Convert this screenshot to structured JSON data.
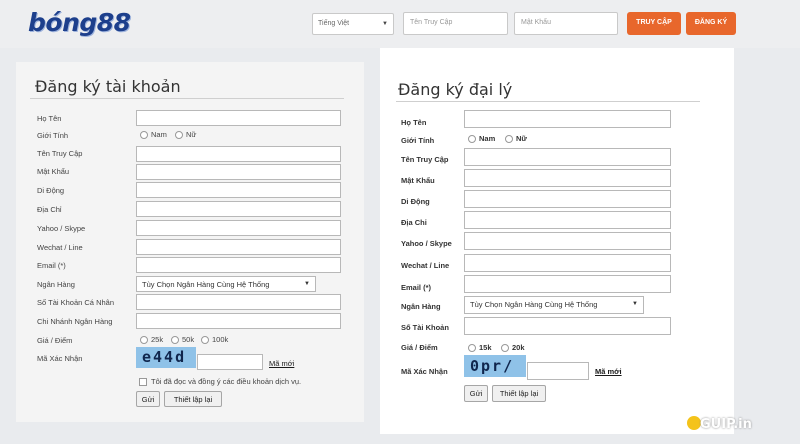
{
  "header": {
    "logo": "bóng88",
    "language": "Tiếng Việt",
    "username_placeholder": "Tên Truy Cập",
    "password_placeholder": "Mật Khẩu",
    "login_button": "TRUY CẬP",
    "register_button": "ĐĂNG KÝ"
  },
  "account_form": {
    "title": "Đăng ký tài khoản",
    "labels": {
      "fullname": "Họ Tên",
      "gender": "Giới Tính",
      "username": "Tên Truy Cập",
      "password": "Mật Khẩu",
      "mobile": "Di Động",
      "address": "Địa Chỉ",
      "yahoo": "Yahoo / Skype",
      "wechat": "Wechat / Line",
      "email": "Email (*)",
      "bank": "Ngân Hàng",
      "account_number": "Số Tài Khoản Cá Nhân",
      "branch": "Chi Nhánh Ngân Hàng",
      "price": "Giá / Điểm",
      "captcha": "Mã Xác Nhận"
    },
    "gender_options": [
      "Nam",
      "Nữ"
    ],
    "bank_selected": "Tùy Chọn Ngân Hàng Cùng Hệ Thống",
    "price_options": [
      "25k",
      "50k",
      "100k"
    ],
    "captcha_text": "e44d",
    "refresh_link": "Mã mới",
    "terms": "Tôi đã đọc và đồng ý các điều khoản dịch vụ.",
    "submit": "Gửi",
    "reset": "Thiết lập lại"
  },
  "agent_form": {
    "title": "Đăng ký đại lý",
    "labels": {
      "fullname": "Họ Tên",
      "gender": "Giới Tính",
      "username": "Tên Truy Cập",
      "password": "Mật Khẩu",
      "mobile": "Di Động",
      "address": "Địa Chỉ",
      "yahoo": "Yahoo / Skype",
      "wechat": "Wechat / Line",
      "email": "Email (*)",
      "bank": "Ngân Hàng",
      "account_number": "Số Tài Khoản",
      "price": "Giá / Điểm",
      "captcha": "Mã Xác Nhận"
    },
    "gender_options": [
      "Nam",
      "Nữ"
    ],
    "bank_selected": "Tùy Chọn Ngân Hàng Cùng Hệ Thống",
    "price_options": [
      "15k",
      "20k"
    ],
    "captcha_text": "0pr/",
    "refresh_link": "Mã mới",
    "submit": "Gửi",
    "reset": "Thiết lập lại"
  },
  "watermark": "GUIP.in",
  "colors": {
    "accent": "#e8672c",
    "logo": "#1d3f8c",
    "captcha_bg": "#8fc2e8"
  }
}
